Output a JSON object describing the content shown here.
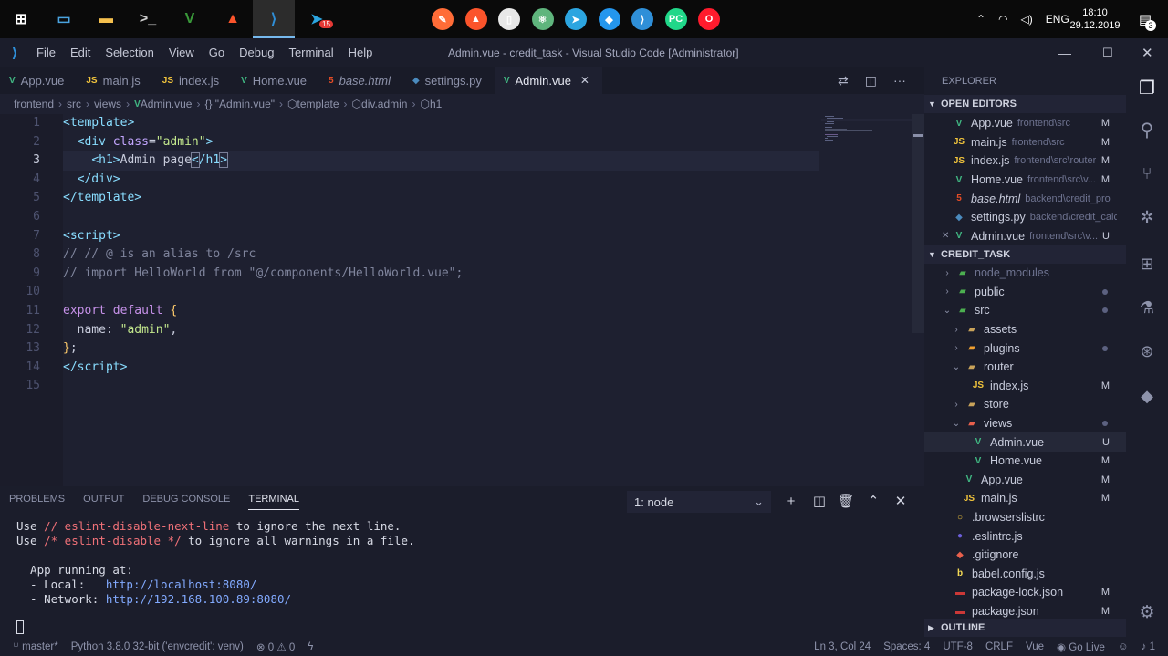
{
  "taskbar": {
    "icons": [
      {
        "name": "windows-start-icon",
        "glyph": "⊞",
        "color": "#ffffff"
      },
      {
        "name": "this-pc-icon",
        "glyph": "▭",
        "color": "#4aa3df"
      },
      {
        "name": "file-explorer-icon",
        "glyph": "▬",
        "color": "#f5c04e"
      },
      {
        "name": "terminal-icon",
        "glyph": ">_",
        "color": "#cfcfcf"
      },
      {
        "name": "vim-icon",
        "glyph": "V",
        "color": "#3a9a3a"
      },
      {
        "name": "brave-icon",
        "glyph": "▲",
        "color": "#fb542b"
      },
      {
        "name": "vscode-icon",
        "glyph": "⟩",
        "color": "#2f8fd8"
      },
      {
        "name": "telegram-icon",
        "glyph": "➤",
        "color": "#2ca5e0"
      }
    ],
    "telegram_badge": "15",
    "center_icons": [
      {
        "name": "postman-icon",
        "glyph": "✎",
        "color": "#ff6c37"
      },
      {
        "name": "brave-icon-2",
        "glyph": "▲",
        "color": "#fb542b"
      },
      {
        "name": "document-icon",
        "glyph": "▯",
        "color": "#e8e8e8"
      },
      {
        "name": "atom-icon",
        "glyph": "⚛",
        "color": "#5fb57d"
      },
      {
        "name": "telegram-icon-2",
        "glyph": "➤",
        "color": "#2ca5e0"
      },
      {
        "name": "docker-icon",
        "glyph": "◆",
        "color": "#2496ed"
      },
      {
        "name": "vscode-icon-2",
        "glyph": "⟩",
        "color": "#2f8fd8"
      },
      {
        "name": "pycharm-icon",
        "glyph": "PC",
        "color": "#21d789"
      },
      {
        "name": "opera-icon",
        "glyph": "O",
        "color": "#ff1b2d"
      }
    ],
    "language": "ENG",
    "time": "18:10",
    "date": "29.12.2019",
    "notification_count": "3"
  },
  "titlebar": {
    "menus": [
      "File",
      "Edit",
      "Selection",
      "View",
      "Go",
      "Debug",
      "Terminal",
      "Help"
    ],
    "title": "Admin.vue - credit_task - Visual Studio Code [Administrator]"
  },
  "tabs": [
    {
      "label": "App.vue",
      "type": "vue",
      "italic": false,
      "active": false
    },
    {
      "label": "main.js",
      "type": "js",
      "italic": false,
      "active": false
    },
    {
      "label": "index.js",
      "type": "js",
      "italic": false,
      "active": false
    },
    {
      "label": "Home.vue",
      "type": "vue",
      "italic": false,
      "active": false
    },
    {
      "label": "base.html",
      "type": "html",
      "italic": true,
      "active": false
    },
    {
      "label": "settings.py",
      "type": "py",
      "italic": false,
      "active": false
    },
    {
      "label": "Admin.vue",
      "type": "vue",
      "italic": false,
      "active": true
    }
  ],
  "breadcrumb": [
    "frontend",
    "src",
    "views",
    "Admin.vue",
    "{} \"Admin.vue\"",
    "template",
    "div.admin",
    "h1"
  ],
  "editor": {
    "line_numbers": [
      "1",
      "2",
      "3",
      "4",
      "5",
      "6",
      "7",
      "8",
      "9",
      "10",
      "11",
      "12",
      "13",
      "14",
      "15"
    ]
  },
  "panel": {
    "tabs": [
      "PROBLEMS",
      "OUTPUT",
      "DEBUG CONSOLE",
      "TERMINAL"
    ],
    "active_tab": "TERMINAL",
    "terminal_select": "1: node",
    "lines": {
      "l1a": "Use ",
      "l1b": "// eslint-disable-next-line",
      "l1c": " to ignore the next line.",
      "l2a": "Use ",
      "l2b": "/* eslint-disable */",
      "l2c": " to ignore all warnings in a file.",
      "l3": "  App running at:",
      "l4a": "  - Local:   ",
      "l4b": "http://localhost:8080/",
      "l5a": "  - Network: ",
      "l5b": "http://192.168.100.89:8080/"
    }
  },
  "explorer": {
    "title": "EXPLORER",
    "open_editors_label": "OPEN EDITORS",
    "open_editors": [
      {
        "name": "App.vue",
        "desc": "frontend\\src",
        "badge": "M",
        "type": "vue"
      },
      {
        "name": "main.js",
        "desc": "frontend\\src",
        "badge": "M",
        "type": "js"
      },
      {
        "name": "index.js",
        "desc": "frontend\\src\\router",
        "badge": "M",
        "type": "js"
      },
      {
        "name": "Home.vue",
        "desc": "frontend\\src\\v...",
        "badge": "M",
        "type": "vue"
      },
      {
        "name": "base.html",
        "desc": "backend\\credit_prod...",
        "badge": "",
        "type": "html"
      },
      {
        "name": "settings.py",
        "desc": "backend\\credit_calc",
        "badge": "",
        "type": "py"
      },
      {
        "name": "Admin.vue",
        "desc": "frontend\\src\\v...",
        "badge": "U",
        "type": "vue"
      }
    ],
    "project_label": "CREDIT_TASK",
    "tree": [
      {
        "name": "node_modules",
        "indent": 1,
        "folder": true,
        "open": false,
        "dim": true,
        "mark": ""
      },
      {
        "name": "public",
        "indent": 1,
        "folder": true,
        "open": false,
        "dim": false,
        "mark": "dot"
      },
      {
        "name": "src",
        "indent": 1,
        "folder": true,
        "open": true,
        "dim": false,
        "mark": "dot"
      },
      {
        "name": "assets",
        "indent": 2,
        "folder": true,
        "open": false,
        "dim": false,
        "mark": ""
      },
      {
        "name": "plugins",
        "indent": 2,
        "folder": true,
        "open": false,
        "dim": false,
        "mark": "dot"
      },
      {
        "name": "router",
        "indent": 2,
        "folder": true,
        "open": true,
        "dim": false,
        "mark": ""
      },
      {
        "name": "index.js",
        "indent": 3,
        "folder": false,
        "type": "js",
        "mark": "M"
      },
      {
        "name": "store",
        "indent": 2,
        "folder": true,
        "open": false,
        "dim": false,
        "mark": ""
      },
      {
        "name": "views",
        "indent": 2,
        "folder": true,
        "open": true,
        "dim": false,
        "mark": "dot"
      },
      {
        "name": "Admin.vue",
        "indent": 3,
        "folder": false,
        "type": "vue",
        "mark": "U",
        "sel": true
      },
      {
        "name": "Home.vue",
        "indent": 3,
        "folder": false,
        "type": "vue",
        "mark": "M"
      },
      {
        "name": "App.vue",
        "indent": 2,
        "folder": false,
        "type": "vue",
        "mark": "M"
      },
      {
        "name": "main.js",
        "indent": 2,
        "folder": false,
        "type": "js",
        "mark": "M"
      },
      {
        "name": ".browserslistrc",
        "indent": 1,
        "folder": false,
        "type": "cfg",
        "mark": ""
      },
      {
        "name": ".eslintrc.js",
        "indent": 1,
        "folder": false,
        "type": "eslint",
        "mark": ""
      },
      {
        "name": ".gitignore",
        "indent": 1,
        "folder": false,
        "type": "git",
        "mark": ""
      },
      {
        "name": "babel.config.js",
        "indent": 1,
        "folder": false,
        "type": "babel",
        "mark": ""
      },
      {
        "name": "package-lock.json",
        "indent": 1,
        "folder": false,
        "type": "npm",
        "mark": "M"
      },
      {
        "name": "package.json",
        "indent": 1,
        "folder": false,
        "type": "npm",
        "mark": "M"
      }
    ],
    "outline_label": "OUTLINE"
  },
  "statusbar": {
    "branch": "master*",
    "python": "Python 3.8.0 32-bit ('envcredit': venv)",
    "errors": "0",
    "warnings": "0",
    "position": "Ln 3, Col 24",
    "spaces": "Spaces: 4",
    "encoding": "UTF-8",
    "eol": "CRLF",
    "language": "Vue",
    "golive": "Go Live",
    "bell_count": "1"
  },
  "colors": {
    "vue": "#41b883",
    "js": "#f0c33c",
    "html": "#e34c26",
    "py": "#4b8bbe",
    "accent": "#76b9ed"
  }
}
